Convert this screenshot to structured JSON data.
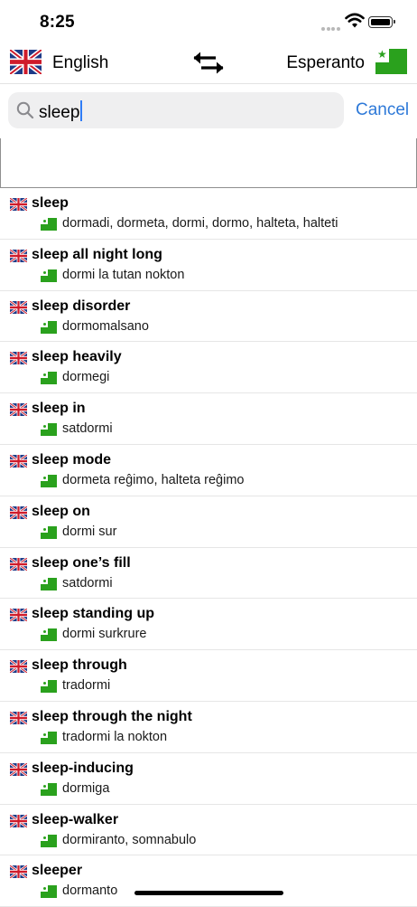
{
  "status": {
    "time": "8:25"
  },
  "langbar": {
    "source": "English",
    "target": "Esperanto"
  },
  "search": {
    "value": "sleep",
    "cancel_label": "Cancel"
  },
  "results": [
    {
      "term": "sleep",
      "translation": "dormadi, dormeta, dormi, dormo, halteta, halteti"
    },
    {
      "term": "sleep all night long",
      "translation": "dormi la tutan nokton"
    },
    {
      "term": "sleep disorder",
      "translation": "dormomalsano"
    },
    {
      "term": "sleep heavily",
      "translation": "dormegi"
    },
    {
      "term": "sleep in",
      "translation": "satdormi"
    },
    {
      "term": "sleep mode",
      "translation": "dormeta reĝimo, halteta reĝimo"
    },
    {
      "term": "sleep on",
      "translation": "dormi sur"
    },
    {
      "term": "sleep one’s fill",
      "translation": "satdormi"
    },
    {
      "term": "sleep standing up",
      "translation": "dormi surkrure"
    },
    {
      "term": "sleep through",
      "translation": "tradormi"
    },
    {
      "term": "sleep through the night",
      "translation": "tradormi la nokton"
    },
    {
      "term": "sleep-inducing",
      "translation": "dormiga"
    },
    {
      "term": "sleep-walker",
      "translation": "dormiranto, somnabulo"
    },
    {
      "term": "sleeper",
      "translation": "dormanto"
    }
  ]
}
